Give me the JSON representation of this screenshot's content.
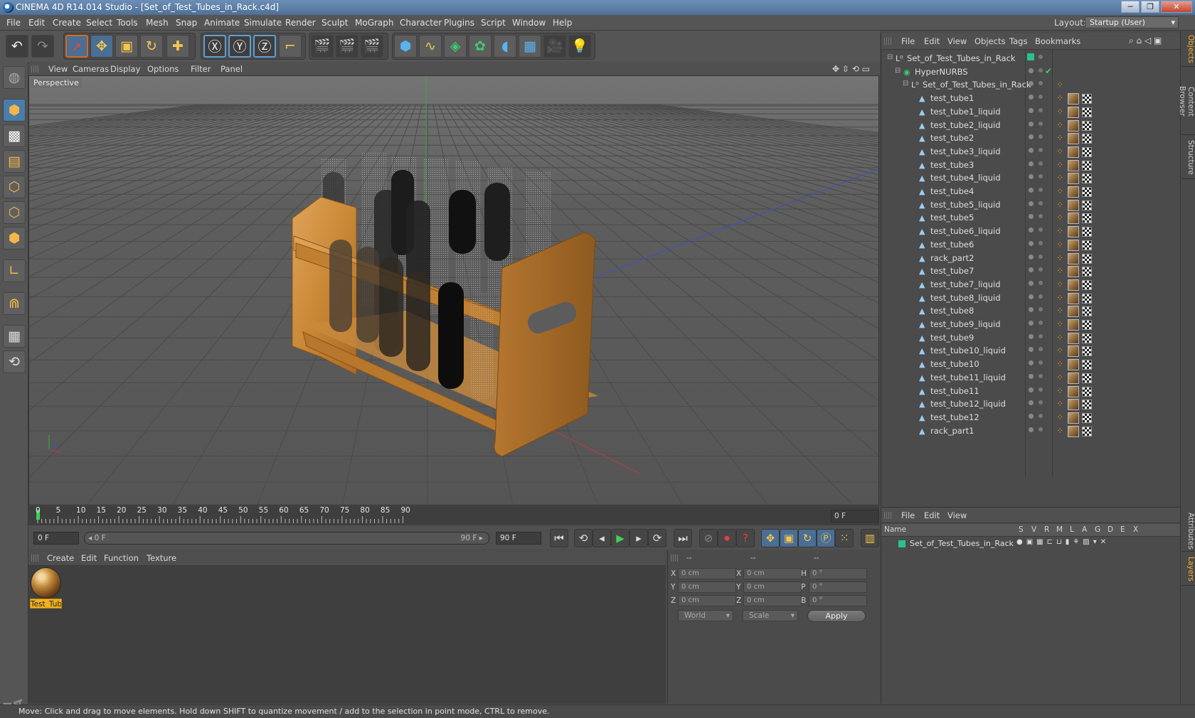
{
  "window": {
    "title": "CINEMA 4D R14.014 Studio - [Set_of_Test_Tubes_in_Rack.c4d]",
    "minimize": "─",
    "maximize": "❐",
    "close": "✕"
  },
  "menubar": {
    "items": [
      "File",
      "Edit",
      "Create",
      "Select",
      "Tools",
      "Mesh",
      "Snap",
      "Animate",
      "Simulate",
      "Render",
      "Sculpt",
      "MoGraph",
      "Character",
      "Plugins",
      "Script",
      "Window",
      "Help"
    ],
    "layout_label": "Layout:",
    "layout_value": "Startup (User)"
  },
  "viewport": {
    "menu": [
      "View",
      "Cameras",
      "Display",
      "Options",
      "Filter",
      "Panel"
    ],
    "label": "Perspective"
  },
  "timeline": {
    "ticks": [
      "0",
      "5",
      "10",
      "15",
      "20",
      "25",
      "30",
      "35",
      "40",
      "45",
      "50",
      "55",
      "60",
      "65",
      "70",
      "75",
      "80",
      "85",
      "90"
    ],
    "current_frame": "0 F"
  },
  "transport": {
    "start_field": "0 F",
    "range_start": "◂ 0 F",
    "range_end": "90 F ▸",
    "end_field": "90 F"
  },
  "material_manager": {
    "menu": [
      "Create",
      "Edit",
      "Function",
      "Texture"
    ],
    "materials": [
      {
        "label": "Test_Tub"
      }
    ]
  },
  "coordinates": {
    "top_labels": [
      "--",
      "--",
      "--"
    ],
    "rows": [
      {
        "a": "X",
        "av": "0 cm",
        "b": "X",
        "bv": "0 cm",
        "c": "H",
        "cv": "0 °"
      },
      {
        "a": "Y",
        "av": "0 cm",
        "b": "Y",
        "bv": "0 cm",
        "c": "P",
        "cv": "0 °"
      },
      {
        "a": "Z",
        "av": "0 cm",
        "b": "Z",
        "bv": "0 cm",
        "c": "B",
        "cv": "0 °"
      }
    ],
    "mode_select": "World",
    "scale_select": "Scale",
    "apply": "Apply"
  },
  "status": "Move: Click and drag to move elements. Hold down SHIFT to quantize movement / add to the selection in point mode, CTRL to remove.",
  "object_manager": {
    "menu": [
      "File",
      "Edit",
      "View",
      "Objects",
      "Tags",
      "Bookmarks"
    ],
    "objects": [
      {
        "name": "Set_of_Test_Tubes_in_Rack",
        "depth": 0,
        "kind": "null"
      },
      {
        "name": "HyperNURBS",
        "depth": 1,
        "kind": "nurbs"
      },
      {
        "name": "Set_of_Test_Tubes_in_Rack",
        "depth": 2,
        "kind": "null"
      },
      {
        "name": "test_tube1",
        "depth": 3,
        "kind": "poly"
      },
      {
        "name": "test_tube1_liquid",
        "depth": 3,
        "kind": "poly"
      },
      {
        "name": "test_tube2_liquid",
        "depth": 3,
        "kind": "poly"
      },
      {
        "name": "test_tube2",
        "depth": 3,
        "kind": "poly"
      },
      {
        "name": "test_tube3_liquid",
        "depth": 3,
        "kind": "poly"
      },
      {
        "name": "test_tube3",
        "depth": 3,
        "kind": "poly"
      },
      {
        "name": "test_tube4_liquid",
        "depth": 3,
        "kind": "poly"
      },
      {
        "name": "test_tube4",
        "depth": 3,
        "kind": "poly"
      },
      {
        "name": "test_tube5_liquid",
        "depth": 3,
        "kind": "poly"
      },
      {
        "name": "test_tube5",
        "depth": 3,
        "kind": "poly"
      },
      {
        "name": "test_tube6_liquid",
        "depth": 3,
        "kind": "poly"
      },
      {
        "name": "test_tube6",
        "depth": 3,
        "kind": "poly"
      },
      {
        "name": "rack_part2",
        "depth": 3,
        "kind": "poly"
      },
      {
        "name": "test_tube7",
        "depth": 3,
        "kind": "poly"
      },
      {
        "name": "test_tube7_liquid",
        "depth": 3,
        "kind": "poly"
      },
      {
        "name": "test_tube8_liquid",
        "depth": 3,
        "kind": "poly"
      },
      {
        "name": "test_tube8",
        "depth": 3,
        "kind": "poly"
      },
      {
        "name": "test_tube9_liquid",
        "depth": 3,
        "kind": "poly"
      },
      {
        "name": "test_tube9",
        "depth": 3,
        "kind": "poly"
      },
      {
        "name": "test_tube10_liquid",
        "depth": 3,
        "kind": "poly"
      },
      {
        "name": "test_tube10",
        "depth": 3,
        "kind": "poly"
      },
      {
        "name": "test_tube11_liquid",
        "depth": 3,
        "kind": "poly"
      },
      {
        "name": "test_tube11",
        "depth": 3,
        "kind": "poly"
      },
      {
        "name": "test_tube12_liquid",
        "depth": 3,
        "kind": "poly"
      },
      {
        "name": "test_tube12",
        "depth": 3,
        "kind": "poly"
      },
      {
        "name": "rack_part1",
        "depth": 3,
        "kind": "poly"
      }
    ]
  },
  "side_tabs": [
    "Objects",
    "Content Browser",
    "Structure"
  ],
  "side_tabs_lower": [
    "Attributes",
    "Layers"
  ],
  "layer_manager": {
    "menu": [
      "File",
      "Edit",
      "View"
    ],
    "columns": [
      "Name",
      "S",
      "V",
      "R",
      "M",
      "L",
      "A",
      "G",
      "D",
      "E",
      "X"
    ],
    "layers": [
      {
        "name": "Set_of_Test_Tubes_in_Rack",
        "color": "#27c48a"
      }
    ]
  },
  "colors": {
    "accent": "#f0b221",
    "selection_blue": "#4a7dab",
    "layer_green": "#27c48a"
  }
}
